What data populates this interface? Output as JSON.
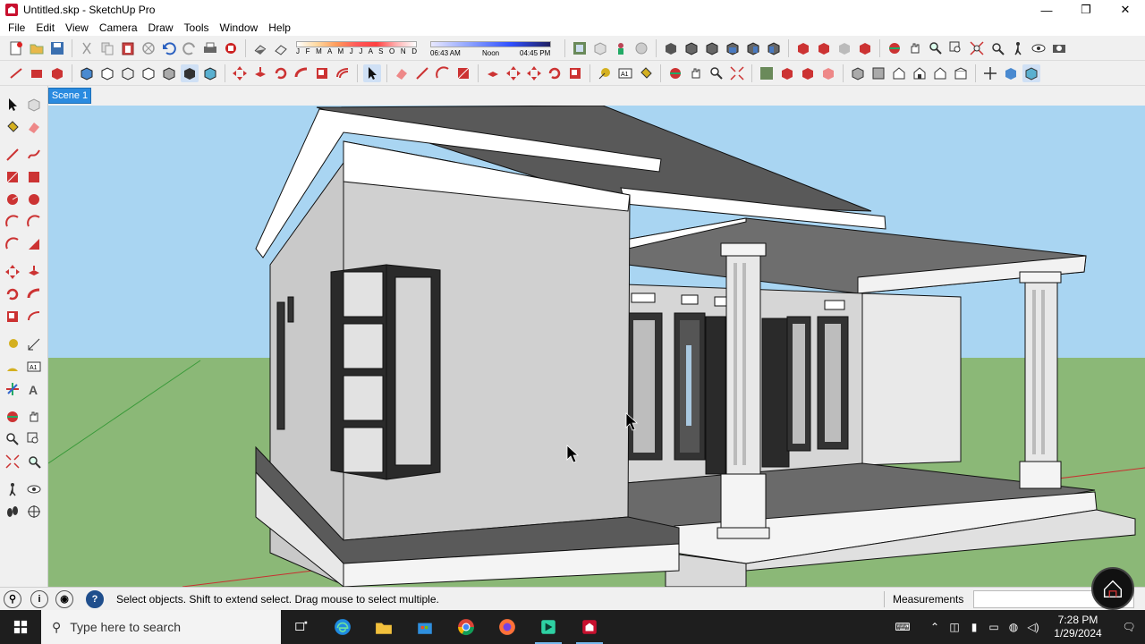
{
  "window": {
    "title": "Untitled.skp - SketchUp Pro",
    "controls": {
      "minimize": "—",
      "maximize": "❐",
      "close": "✕"
    }
  },
  "menu": [
    "File",
    "Edit",
    "View",
    "Camera",
    "Draw",
    "Tools",
    "Window",
    "Help"
  ],
  "shadow_panel": {
    "months": "J F M A M J J A S O N D",
    "time_start": "06:43 AM",
    "time_mid": "Noon",
    "time_end": "04:45 PM"
  },
  "scene_tab": "Scene 1",
  "status": {
    "hint": "Select objects. Shift to extend select. Drag mouse to select multiple.",
    "measurements_label": "Measurements",
    "measurements_value": ""
  },
  "taskbar": {
    "search_placeholder": "Type here to search",
    "time": "7:28 PM",
    "date": "1/29/2024"
  },
  "colors": {
    "sky": "#a9d5f2",
    "ground": "#8bb877",
    "accent": "#2a8be0"
  }
}
